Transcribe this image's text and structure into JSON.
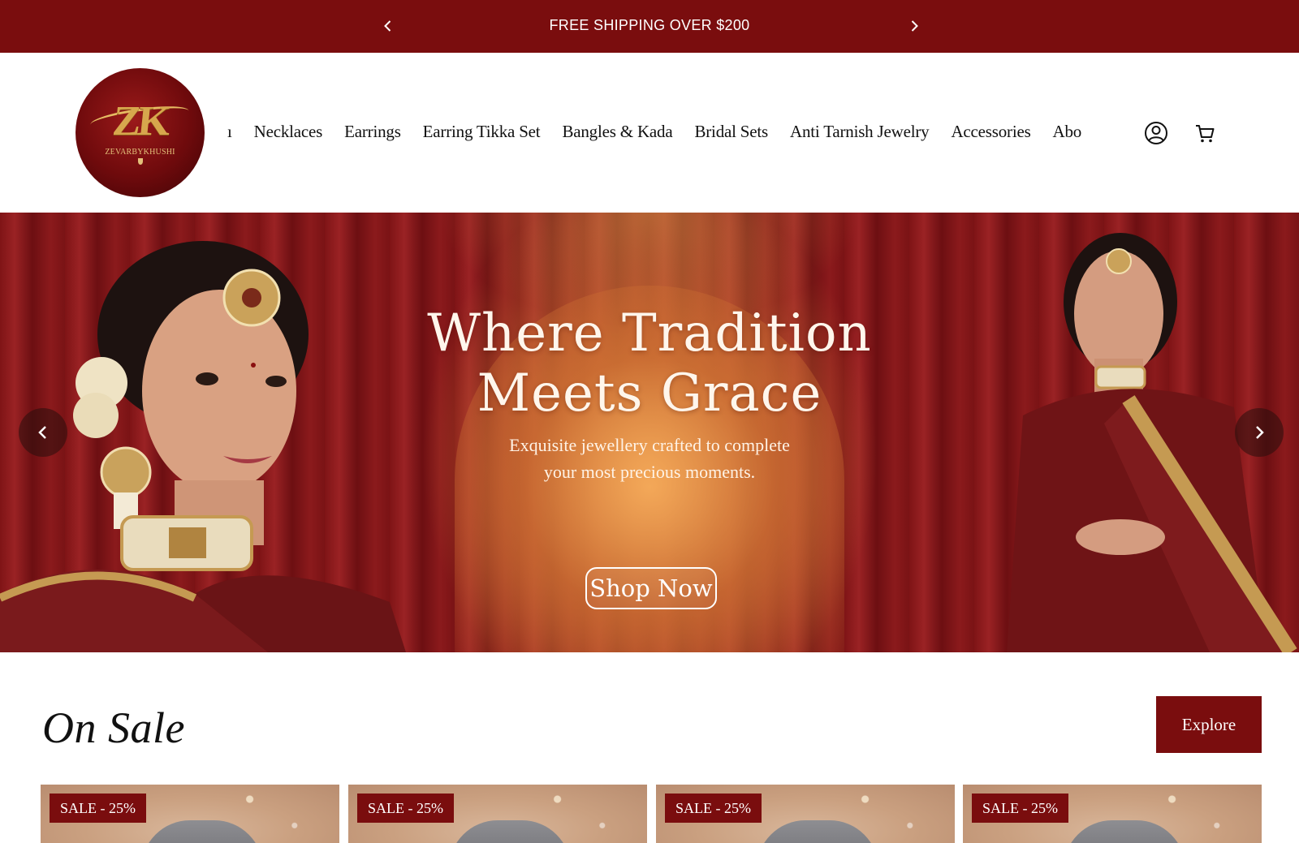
{
  "announcement": {
    "message": "FREE SHIPPING OVER $200"
  },
  "header": {
    "brand": {
      "monogram": "ZK",
      "name": "ZEVARBYKHUSHI"
    },
    "nav_items": [
      {
        "label": "ı"
      },
      {
        "label": "Necklaces"
      },
      {
        "label": "Earrings"
      },
      {
        "label": "Earring Tikka Set"
      },
      {
        "label": "Bangles & Kada"
      },
      {
        "label": "Bridal Sets"
      },
      {
        "label": "Anti Tarnish Jewelry"
      },
      {
        "label": "Accessories"
      },
      {
        "label": "Abo"
      }
    ],
    "icons": {
      "account": "account-icon",
      "cart": "cart-icon"
    }
  },
  "hero": {
    "title_line1": "Where Tradition",
    "title_line2": "Meets Grace",
    "subtitle_line1": "Exquisite jewellery crafted to complete",
    "subtitle_line2": "your most precious moments.",
    "cta_label": "Shop Now"
  },
  "on_sale": {
    "title": "On Sale",
    "explore_label": "Explore",
    "products": [
      {
        "badge": "SALE - 25%"
      },
      {
        "badge": "SALE - 25%"
      },
      {
        "badge": "SALE - 25%"
      },
      {
        "badge": "SALE - 25%"
      }
    ]
  },
  "colors": {
    "brand_maroon": "#7a0d0e",
    "gold": "#d7a74d"
  }
}
